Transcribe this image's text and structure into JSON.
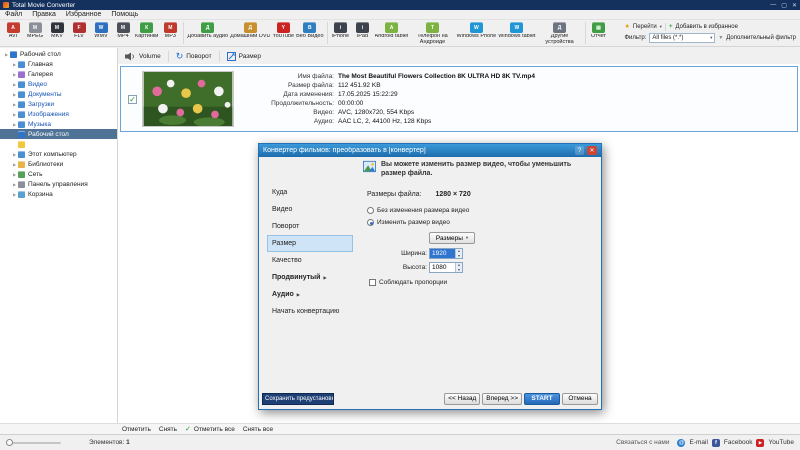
{
  "window": {
    "title": "Total Movie Converter"
  },
  "menu": {
    "items": [
      "Файл",
      "Правка",
      "Избранное",
      "Помощь"
    ]
  },
  "toolbar": {
    "formats": [
      {
        "label": "AVI",
        "color": "#c53b2e"
      },
      {
        "label": "MPEG",
        "color": "#8a8f98"
      },
      {
        "label": "MKV",
        "color": "#30343c"
      },
      {
        "label": "FLV",
        "color": "#b03030"
      },
      {
        "label": "WMV",
        "color": "#2f6fc0"
      },
      {
        "label": "MP4",
        "color": "#4a4f58"
      },
      {
        "label": "Картинки",
        "color": "#3f9e45"
      },
      {
        "label": "MP3",
        "color": "#c0392b"
      }
    ],
    "actions": [
      {
        "label": "Добавить аудио",
        "color": "#3f9e45"
      },
      {
        "label": "Домашний DVD",
        "color": "#c78f2e"
      },
      {
        "label": "YouTube",
        "color": "#cc2222"
      },
      {
        "label": "Веб Видео",
        "color": "#2f7fc0"
      }
    ],
    "devices": [
      {
        "label": "iPhone",
        "color": "#3d434d"
      },
      {
        "label": "iPad",
        "color": "#3d434d"
      },
      {
        "label": "Android tablet",
        "color": "#7cb342"
      },
      {
        "label": "Телефон на Андроиде",
        "color": "#7cb342"
      },
      {
        "label": "Windows Phone",
        "color": "#2196d4"
      },
      {
        "label": "Windows tablet",
        "color": "#2196d4"
      },
      {
        "label": "Другие устройства",
        "color": "#6d7480"
      }
    ],
    "report_label": "Отчет",
    "go_label": "Перейти",
    "favorite_label": "Добавить в избранное",
    "filter_label": "Фильтр:",
    "filter_value": "All files (*.*)",
    "extra_filter_label": "Дополнительный фильтр"
  },
  "toolbar2": {
    "volume_label": "Volume",
    "rotate_label": "Поворот",
    "resize_label": "Размер"
  },
  "sidebar": {
    "items": [
      {
        "label": "Рабочий стол",
        "depth": 0,
        "icon": "desktop",
        "arrow": true
      },
      {
        "label": "Главная",
        "depth": 1,
        "icon": "home",
        "arrow": true
      },
      {
        "label": "Галерея",
        "depth": 1,
        "icon": "gallery",
        "arrow": true
      },
      {
        "label": "Видео",
        "depth": 1,
        "icon": "videos",
        "arrow": true,
        "link": true
      },
      {
        "label": "Документы",
        "depth": 1,
        "icon": "documents",
        "arrow": true,
        "link": true
      },
      {
        "label": "Загрузки",
        "depth": 1,
        "icon": "downloads",
        "arrow": true,
        "link": true
      },
      {
        "label": "Изображения",
        "depth": 1,
        "icon": "pictures",
        "arrow": true,
        "link": true
      },
      {
        "label": "Музыка",
        "depth": 1,
        "icon": "music",
        "arrow": true,
        "link": true
      },
      {
        "label": "Рабочий стол",
        "depth": 1,
        "icon": "desktop",
        "selected": true,
        "link": true
      },
      {
        "label": "",
        "depth": 1,
        "icon": "folder"
      },
      {
        "label": "Этот компьютер",
        "depth": 1,
        "icon": "computer",
        "arrow": true
      },
      {
        "label": "Библиотеки",
        "depth": 1,
        "icon": "library",
        "arrow": true
      },
      {
        "label": "Сеть",
        "depth": 1,
        "icon": "network",
        "arrow": true
      },
      {
        "label": "Панель управления",
        "depth": 1,
        "icon": "control",
        "arrow": true
      },
      {
        "label": "Корзина",
        "depth": 1,
        "icon": "recycle",
        "arrow": true
      }
    ]
  },
  "file": {
    "fields": [
      {
        "label": "Имя файла:",
        "value": "The Most Beautiful Flowers Collection 8K ULTRA HD 8K TV.mp4"
      },
      {
        "label": "Размер файла:",
        "value": "112 451.92 KB"
      },
      {
        "label": "Дата изменения:",
        "value": "17.05.2025 15:22:29"
      },
      {
        "label": "Продолжительность:",
        "value": "00:00:00"
      },
      {
        "label": "Видео:",
        "value": "AVC, 1280x720, 554 Kbps"
      },
      {
        "label": "Аудио:",
        "value": "AAC LC, 2, 44100 Hz, 128 Kbps"
      }
    ]
  },
  "dialog": {
    "title": "Конвертер фильмов: преобразовать в [конвертер]",
    "nav": [
      {
        "label": "Куда"
      },
      {
        "label": "Видео"
      },
      {
        "label": "Поворот"
      },
      {
        "label": "Размер",
        "selected": true
      },
      {
        "label": "Качество"
      },
      {
        "label": "Продвинутый",
        "submenu": true
      },
      {
        "label": "Аудио",
        "submenu": true
      },
      {
        "label": "Начать конвертацию"
      }
    ],
    "info": "Вы можете изменить размер видео, чтобы уменьшить размер файла.",
    "file_size_label": "Размеры файла:",
    "file_size_value": "1280 × 720",
    "radio_keep": "Без изменения размера видео",
    "radio_resize": "Изменить размер видео",
    "sizes_button": "Размеры",
    "width_label": "Ширина:",
    "width_value": "1920",
    "height_label": "Высота:",
    "height_value": "1080",
    "keep_proportions": "Соблюдать пропорции",
    "save_preset": "Сохранить предустановки",
    "back_label": "<< Назад",
    "forward_label": "Вперед >>",
    "start_label": "START",
    "cancel_label": "Отмена",
    "accent_color": "#2f81d6"
  },
  "checkbar": {
    "mark": "Отметить",
    "unmark": "Снять",
    "mark_all": "Отметить все",
    "unmark_all": "Снять все"
  },
  "bottombar": {
    "items_label": "Элементов:",
    "items_count": "1",
    "contact": "Связаться с нами",
    "email": "E-mail",
    "facebook": "Facebook",
    "youtube": "YouTube"
  }
}
